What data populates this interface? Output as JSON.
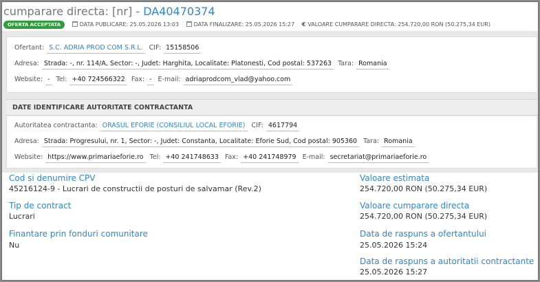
{
  "header": {
    "title_prefix": "cumparare directa: [nr] -",
    "code": "DA40470374"
  },
  "meta": {
    "status_badge": "OFERTA ACCEPTATA",
    "publish_date": "DATA PUBLICARE: 25.05.2026 13:03",
    "final_date": "DATA FINALIZARE: 25.05.2026 15:27",
    "value": "VALOARE CUMPARARE DIRECTA: 254.720,00  RON (50.275,34  EUR)"
  },
  "offerer": {
    "name_label": "Ofertant:",
    "name": "S.C. ADRIA PROD COM S.R.L.",
    "cif_label": "CIF:",
    "cif": "15158506",
    "address_label": "Adresa:",
    "address": "Strada: -, nr. 114/A, Sector: -, Judet: Harghita, Localitate: Platonesti, Cod postal: 537263",
    "country_label": "Tara:",
    "country": "Romania",
    "website_label": "Website:",
    "website": "-",
    "tel_label": "Tel:",
    "tel": "+40 724566322",
    "fax_label": "Fax:",
    "fax": "-",
    "email_label": "E-mail:",
    "email": "adriaprodcom_vlad@yahoo.com"
  },
  "authority": {
    "section_title": "DATE IDENTIFICARE AUTORITATE CONTRACTANTA",
    "name_label": "Autoritatea contractanta:",
    "name": "ORASUL EFORIE (CONSILIUL LOCAL EFORIE)",
    "cif_label": "CIF:",
    "cif": "4617794",
    "address_label": "Adresa:",
    "address": "Strada: Progresului, nr. 1, Sector: -, Judet: Constanta, Localitate: Eforie Sud, Cod postal: 905360",
    "country_label": "Tara:",
    "country": "Romania",
    "website_label": "Website:",
    "website": "https://www.primariaeforie.ro",
    "tel_label": "Tel:",
    "tel": "+40 241748633",
    "fax_label": "Fax:",
    "fax": "+40 241748979",
    "email_label": "E-mail:",
    "email": "secretariat@primariaeforie.ro"
  },
  "details": {
    "cpv_label": "Cod si denumire CPV",
    "cpv_value": "45216124-9 - Lucrari de constructii de posturi de salvamar (Rev.2)",
    "contract_type_label": "Tip de contract",
    "contract_type_value": "Lucrari",
    "eu_funds_label": "Finantare prin fonduri comunitare",
    "eu_funds_value": "Nu",
    "estimated_value_label": "Valoare estimata",
    "estimated_value": "254.720,00  RON (50.275,34  EUR)",
    "purchase_value_label": "Valoare cumparare directa",
    "purchase_value": "254.720,00  RON (50.275,34  EUR)",
    "offerer_reply_label": "Data de raspuns a ofertantului",
    "offerer_reply_value": "25.05.2026 15:24",
    "authority_reply_label": "Data de raspuns a autoritatii contractante",
    "authority_reply_value": "25.05.2026 15:27"
  }
}
